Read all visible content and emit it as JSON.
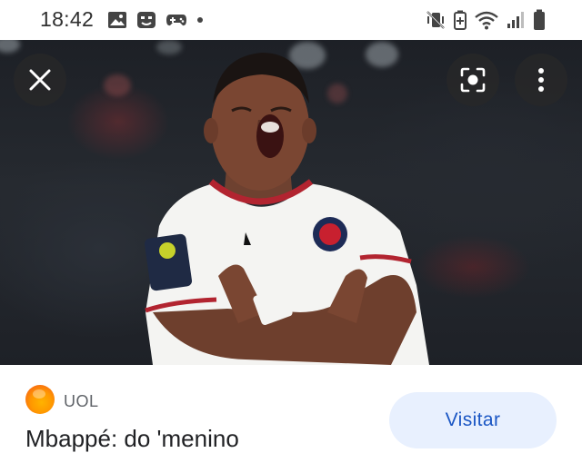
{
  "status_bar": {
    "time": "18:42",
    "left_icons": [
      "gallery-icon",
      "face-icon",
      "gamepad-icon",
      "dot-icon"
    ],
    "right_icons": [
      "mute-vibrate-icon",
      "battery-saver-icon",
      "wifi-icon",
      "signal-icon",
      "battery-icon"
    ]
  },
  "viewer": {
    "image_subject": "football player celebrating with crossed arms",
    "close_icon": "close-icon",
    "lens_icon": "lens-icon",
    "more_icon": "more-vert-icon"
  },
  "source": {
    "name": "UOL",
    "logo_colors": [
      "#ffb300",
      "#ff9800",
      "#f4511e"
    ]
  },
  "article": {
    "title": "Mbappé: do 'menino"
  },
  "actions": {
    "visit_label": "Visitar"
  },
  "colors": {
    "accent": "#1a56c4",
    "button_bg": "#e8f0fe"
  }
}
